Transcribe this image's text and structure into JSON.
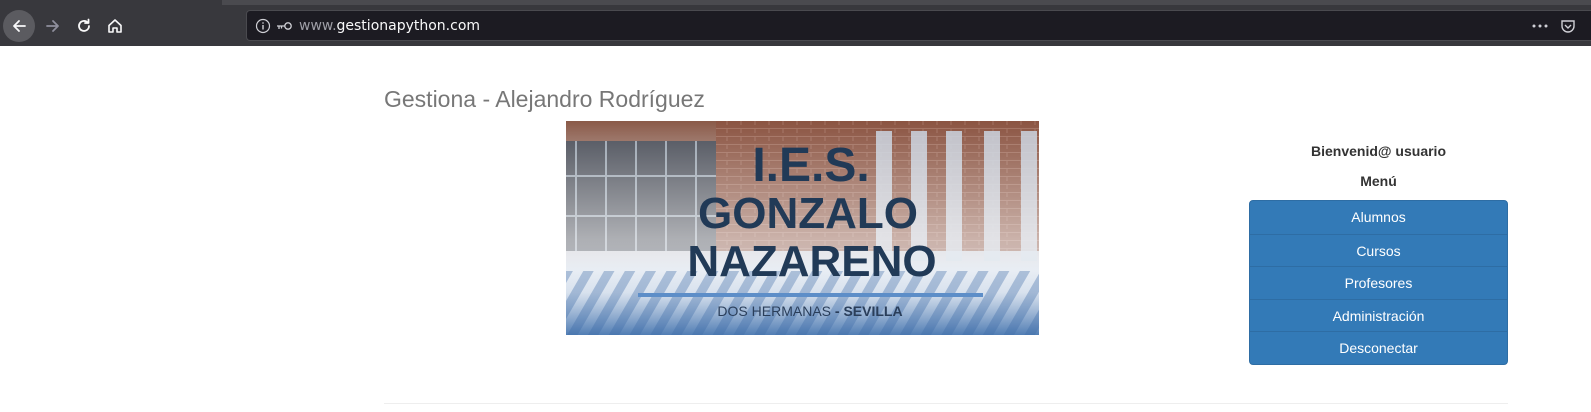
{
  "browser": {
    "url_prefix": "www.",
    "url_domain": "gestionapython.com",
    "icons": [
      "back-icon",
      "forward-icon",
      "reload-icon",
      "home-icon",
      "info-icon",
      "key-icon",
      "more-icon",
      "pocket-icon"
    ]
  },
  "page": {
    "title": "Gestiona - Alejandro Rodríguez"
  },
  "banner": {
    "line1": "I.E.S.",
    "line2": "GONZALO",
    "line3": "NAZARENO",
    "subtitle_city": "DOS HERMANAS",
    "subtitle_sep": " - ",
    "subtitle_province": "SEVILLA"
  },
  "sidebar": {
    "welcome": "Bienvenid@ usuario",
    "menu_title": "Menú",
    "items": [
      {
        "label": "Alumnos"
      },
      {
        "label": "Cursos"
      },
      {
        "label": "Profesores"
      },
      {
        "label": "Administración"
      },
      {
        "label": "Desconectar"
      }
    ]
  },
  "colors": {
    "chrome": "#38383d",
    "urlbar": "#1c1b22",
    "menu_blue": "#337ab7",
    "title_gray": "#777777",
    "banner_navy": "#213a57"
  }
}
